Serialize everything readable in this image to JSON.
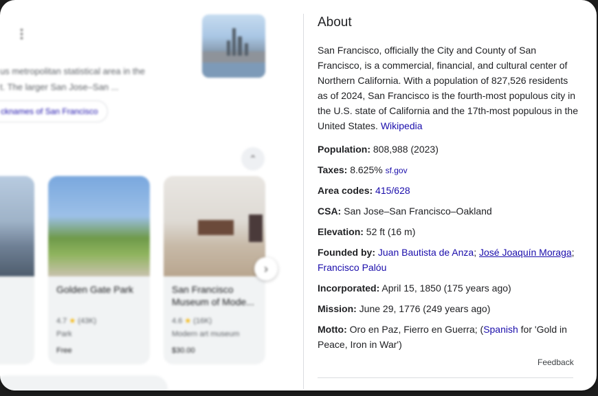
{
  "left_panel": {
    "text_line1": "us metropolitan statistical area in the",
    "text_line2": "t. The larger San Jose–San ...",
    "chip_label": "cknames of San Francisco",
    "places": [
      {
        "title": "Golden Gate Park",
        "rating": "4.7",
        "reviews": "(43K)",
        "category": "Park",
        "price": "Free"
      },
      {
        "title": "San Francisco Museum of Mode...",
        "rating": "4.6",
        "reviews": "(16K)",
        "category": "Modern art museum",
        "price": "$30.00"
      }
    ]
  },
  "about": {
    "title": "About",
    "description": "San Francisco, officially the City and County of San Francisco, is a commercial, financial, and cultural center of Northern California. With a population of 827,526 residents as of 2024, San Francisco is the fourth-most populous city in the U.S. state of California and the 17th-most populous in the United States.",
    "source_link": "Wikipedia",
    "facts": {
      "population": {
        "label": "Population:",
        "value": "808,988 (2023)"
      },
      "taxes": {
        "label": "Taxes:",
        "value": "8.625%",
        "link": "sf.gov"
      },
      "area_codes": {
        "label": "Area codes:",
        "value": "415/628"
      },
      "csa": {
        "label": "CSA:",
        "value": "San Jose–San Francisco–Oakland"
      },
      "elevation": {
        "label": "Elevation:",
        "value": "52 ft (16 m)"
      },
      "founded_by": {
        "label": "Founded by:",
        "people": [
          "Juan Bautista de Anza",
          "José Joaquín Moraga",
          "Francisco Palóu"
        ]
      },
      "incorporated": {
        "label": "Incorporated:",
        "value": "April 15, 1850 (175 years ago)"
      },
      "mission": {
        "label": "Mission:",
        "value": "June 29, 1776 (249 years ago)"
      },
      "motto": {
        "label": "Motto:",
        "value": "Oro en Paz, Fierro en Guerra; (",
        "lang_link": "Spanish",
        "translation": " for 'Gold in Peace, Iron in War')"
      }
    },
    "feedback": "Feedback"
  },
  "colors": {
    "link": "#1a0dab",
    "text": "#202124",
    "muted": "#5f6368",
    "star": "#f5b400"
  }
}
